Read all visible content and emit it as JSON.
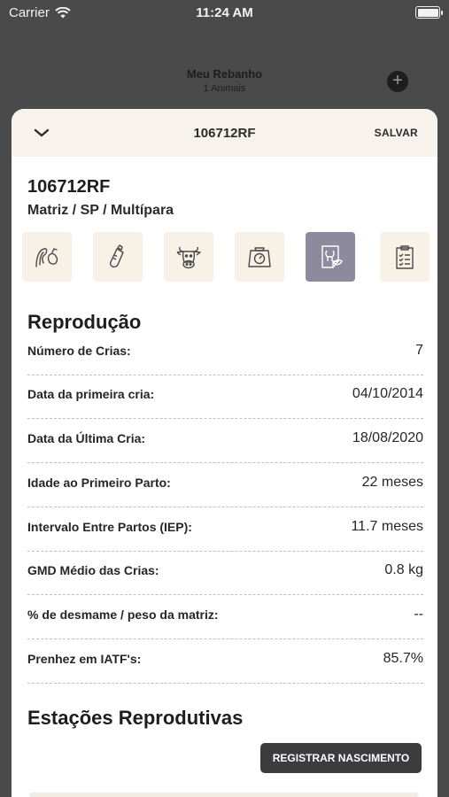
{
  "status_bar": {
    "carrier": "Carrier",
    "time": "11:24 AM"
  },
  "background": {
    "title": "Meu Rebanho",
    "subtitle": "1 Animais",
    "add_glyph": "+"
  },
  "sheet": {
    "header_title": "106712RF",
    "save_label": "SALVAR",
    "animal_id": "106712RF",
    "animal_description": "Matriz / SP / Multípara",
    "icons": [
      {
        "name": "birth-icon",
        "active": false
      },
      {
        "name": "bottle-icon",
        "active": false
      },
      {
        "name": "cow-icon",
        "active": false
      },
      {
        "name": "scale-icon",
        "active": false
      },
      {
        "name": "reproduction-icon",
        "active": true
      },
      {
        "name": "clipboard-icon",
        "active": false
      }
    ],
    "reproduction": {
      "title": "Reprodução",
      "rows": [
        {
          "label": "Número de Crias:",
          "value": "7"
        },
        {
          "label": "Data da primeira cria:",
          "value": "04/10/2014"
        },
        {
          "label": "Data da Última Cria:",
          "value": "18/08/2020"
        },
        {
          "label": "Idade ao Primeiro Parto:",
          "value": "22 meses"
        },
        {
          "label": "Intervalo Entre Partos (IEP):",
          "value": "11.7 meses"
        },
        {
          "label": "GMD Médio das Crias:",
          "value": "0.8 kg"
        },
        {
          "label": "% de desmame / peso da matriz:",
          "value": "--"
        },
        {
          "label": "Prenhez em IATF's:",
          "value": "85.7%"
        }
      ]
    },
    "stations": {
      "title": "Estações Reprodutivas",
      "register_label": "REGISTRAR NASCIMENTO"
    }
  },
  "colors": {
    "overlay": "#4a4a4a",
    "sheet_header": "#f7f3ec",
    "icon_bg": "#f7f1e6",
    "icon_active": "#8c8a9c",
    "button": "#3c3c3f"
  }
}
